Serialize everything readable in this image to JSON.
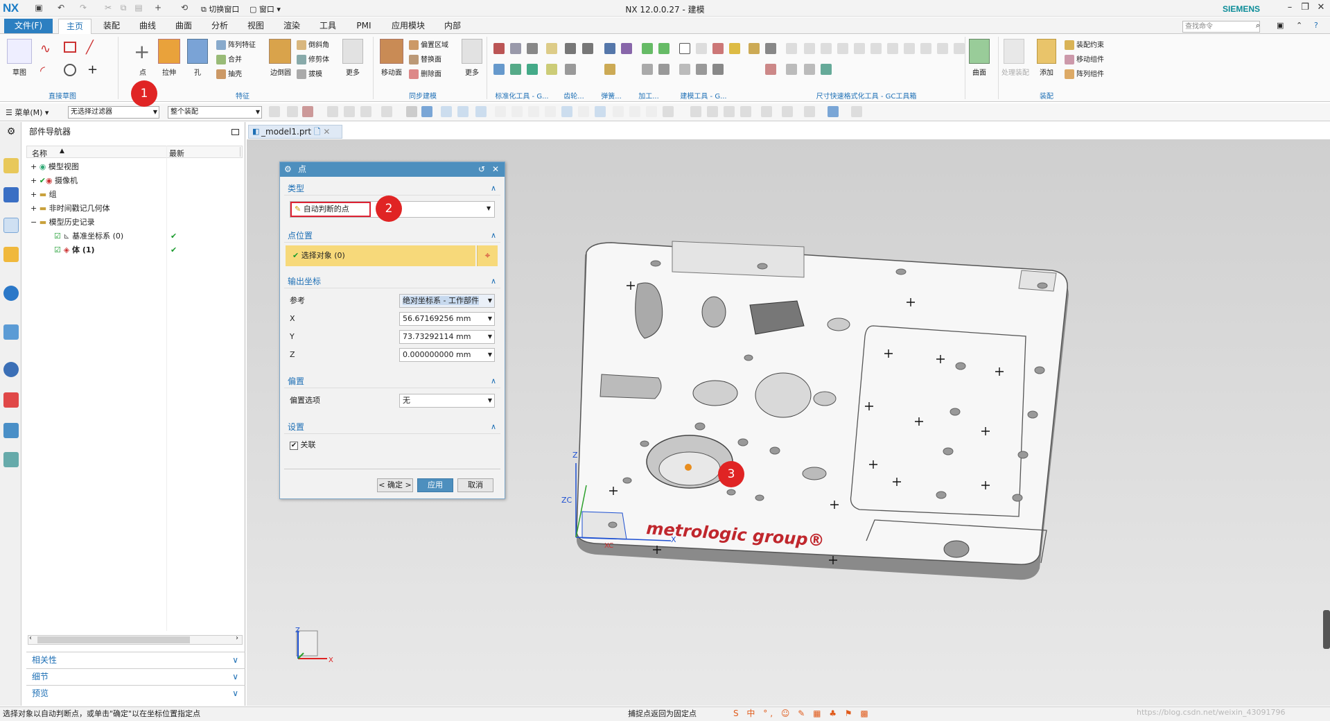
{
  "app": {
    "logo": "NX",
    "title": "NX 12.0.0.27 - 建模",
    "vendor": "SIEMENS"
  },
  "quickaccess": {
    "switch_window": "切换窗口",
    "window": "窗口"
  },
  "tabs": [
    "文件(F)",
    "主页",
    "装配",
    "曲线",
    "曲面",
    "分析",
    "视图",
    "渲染",
    "工具",
    "PMI",
    "应用模块",
    "内部"
  ],
  "search_placeholder": "查找命令",
  "ribbon": {
    "sketch": "草图",
    "point": "点",
    "extrude": "拉伸",
    "hole": "孔",
    "more": "更多",
    "edge_blend": "边倒圆",
    "pattern_feature": "阵列特征",
    "unite": "合并",
    "shell": "抽壳",
    "chamfer": "倒斜角",
    "trim_body": "修剪体",
    "draft": "拔模",
    "move_face": "移动面",
    "offset_region": "偏置区域",
    "replace_face": "替换面",
    "delete_face": "删除面",
    "more2": "更多",
    "surface": "曲面",
    "process_assembly": "处理装配",
    "add": "添加",
    "assembly_constraint": "装配约束",
    "move_component": "移动组件",
    "pattern_component": "阵列组件",
    "groups": {
      "direct_sketch": "直接草图",
      "feature": "特征",
      "sync_model": "同步建模",
      "std_tools": "标准化工具 - G...",
      "gear": "齿轮...",
      "spring": "弹簧...",
      "machining": "加工...",
      "modeling_tools": "建模工具 - G...",
      "dim_tools": "尺寸快速格式化工具 - GC工具箱",
      "assembly": "装配"
    }
  },
  "toolbar": {
    "menu": "菜单(M)",
    "filter": "无选择过滤器",
    "scope": "整个装配"
  },
  "navigator": {
    "title": "部件导航器",
    "col_name": "名称",
    "col_latest": "最新",
    "items": [
      {
        "label": "模型视图"
      },
      {
        "label": "摄像机"
      },
      {
        "label": "组"
      },
      {
        "label": "非时间戳记几何体"
      },
      {
        "label": "模型历史记录"
      },
      {
        "label": "基准坐标系 (0)"
      },
      {
        "label": "体 (1)"
      }
    ],
    "panels": [
      "相关性",
      "细节",
      "预览"
    ]
  },
  "gfx_tab": "_model1.prt",
  "dialog": {
    "title": "点",
    "type_section": "类型",
    "type_value": "自动判断的点",
    "pos_section": "点位置",
    "select_object": "选择对象 (0)",
    "out_section": "输出坐标",
    "ref_label": "参考",
    "ref_value": "绝对坐标系 - 工作部件",
    "x_label": "X",
    "x_value": "56.67169256",
    "x_unit": "mm",
    "y_label": "Y",
    "y_value": "73.73292114",
    "y_unit": "mm",
    "z_label": "Z",
    "z_value": "0.000000000",
    "z_unit": "mm",
    "offset_section": "偏置",
    "offset_label": "偏置选项",
    "offset_value": "无",
    "settings_section": "设置",
    "assoc_label": "关联",
    "ok": "< 确定 >",
    "apply": "应用",
    "cancel": "取消"
  },
  "model": {
    "brand_text": "metrologic group®"
  },
  "axes": {
    "x": "X",
    "y": "Y",
    "z": "Z",
    "zc": "ZC",
    "xc": "XC"
  },
  "status": {
    "left": "选择对象以自动判断点，或单击\"确定\"以在坐标位置指定点",
    "center": "捕捉点返回为固定点",
    "watermark": "https://blog.csdn.net/weixin_43091796"
  },
  "badges": [
    "1",
    "2",
    "3"
  ],
  "colors": {
    "accent": "#1d6fb5",
    "file_tab": "#2c7fc1",
    "dialog_title": "#4d8fbe",
    "badge": "#e02424",
    "select_row": "#f7d97a"
  }
}
